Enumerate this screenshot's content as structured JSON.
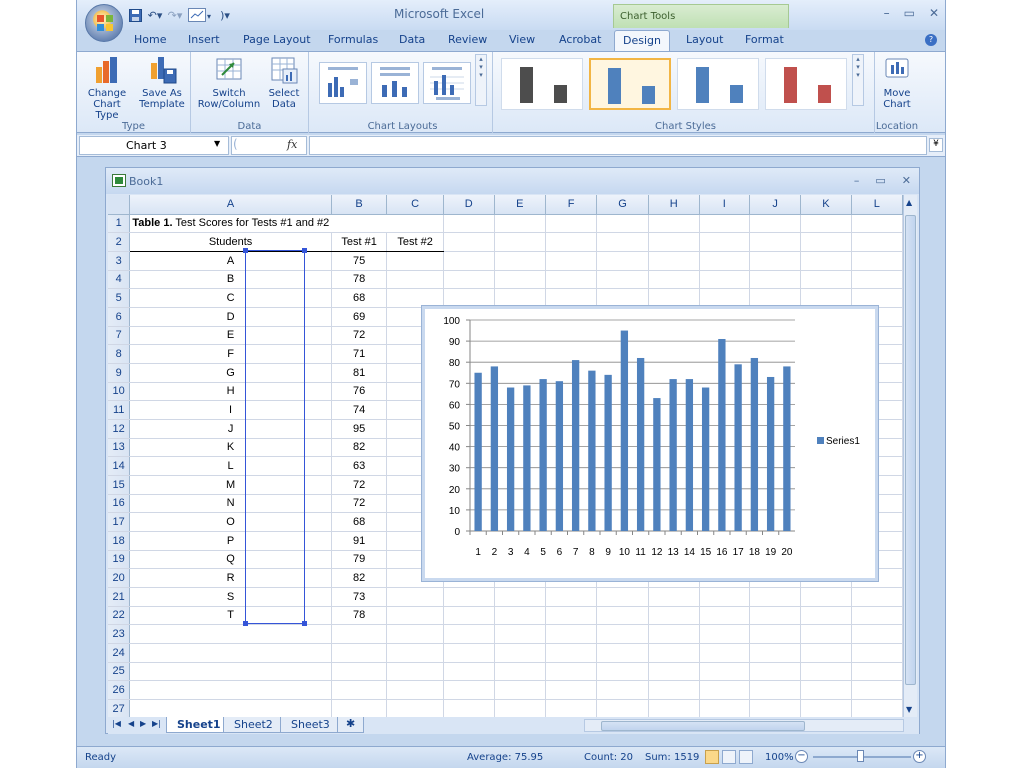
{
  "app": {
    "title": "Microsoft Excel",
    "context_tab_group": "Chart Tools"
  },
  "ribbon_tabs": [
    "Home",
    "Insert",
    "Page Layout",
    "Formulas",
    "Data",
    "Review",
    "View",
    "Acrobat",
    "Design",
    "Layout",
    "Format"
  ],
  "active_tab": "Design",
  "ribbon": {
    "groups": {
      "type": "Type",
      "data": "Data",
      "layouts": "Chart Layouts",
      "styles": "Chart Styles",
      "location": "Location"
    },
    "change_chart_type": [
      "Change",
      "Chart Type"
    ],
    "save_as_template": [
      "Save As",
      "Template"
    ],
    "switch_row_column": [
      "Switch",
      "Row/Column"
    ],
    "select_data": [
      "Select",
      "Data"
    ],
    "move_chart": [
      "Move",
      "Chart"
    ],
    "style_colors": [
      "#4d4d4d",
      "#4f81bd",
      "#4f81bd",
      "#c0504d"
    ]
  },
  "formula_bar": {
    "name_box": "Chart 3",
    "fx": "fx",
    "formula": ""
  },
  "workbook": {
    "title": "Book1"
  },
  "columns": [
    "A",
    "B",
    "C",
    "D",
    "E",
    "F",
    "G",
    "H",
    "I",
    "J",
    "K",
    "L"
  ],
  "sheet": {
    "title": "Table 1.",
    "title_rest": "Test Scores for Tests #1 and #2",
    "headers": [
      "Students",
      "Test #1",
      "Test #2"
    ],
    "rows": [
      [
        "A",
        "75"
      ],
      [
        "B",
        "78"
      ],
      [
        "C",
        "68"
      ],
      [
        "D",
        "69"
      ],
      [
        "E",
        "72"
      ],
      [
        "F",
        "71"
      ],
      [
        "G",
        "81"
      ],
      [
        "H",
        "76"
      ],
      [
        "I",
        "74"
      ],
      [
        "J",
        "95"
      ],
      [
        "K",
        "82"
      ],
      [
        "L",
        "63"
      ],
      [
        "M",
        "72"
      ],
      [
        "N",
        "72"
      ],
      [
        "O",
        "68"
      ],
      [
        "P",
        "91"
      ],
      [
        "Q",
        "79"
      ],
      [
        "R",
        "82"
      ],
      [
        "S",
        "73"
      ],
      [
        "T",
        "78"
      ]
    ],
    "row_count": 27
  },
  "chart_data": {
    "type": "bar",
    "categories": [
      "1",
      "2",
      "3",
      "4",
      "5",
      "6",
      "7",
      "8",
      "9",
      "10",
      "11",
      "12",
      "13",
      "14",
      "15",
      "16",
      "17",
      "18",
      "19",
      "20"
    ],
    "series": [
      {
        "name": "Series1",
        "values": [
          75,
          78,
          68,
          69,
          72,
          71,
          81,
          76,
          74,
          95,
          82,
          63,
          72,
          72,
          68,
          91,
          79,
          82,
          73,
          78
        ],
        "color": "#4f81bd"
      }
    ],
    "ylim": [
      0,
      100
    ],
    "yticks": [
      0,
      10,
      20,
      30,
      40,
      50,
      60,
      70,
      80,
      90,
      100
    ],
    "grid": true,
    "legend": "right"
  },
  "sheet_tabs": [
    "Sheet1",
    "Sheet2",
    "Sheet3"
  ],
  "active_sheet": "Sheet1",
  "status": {
    "ready": "Ready",
    "average": "Average: 75.95",
    "count": "Count: 20",
    "sum": "Sum: 1519",
    "zoom": "100%"
  }
}
